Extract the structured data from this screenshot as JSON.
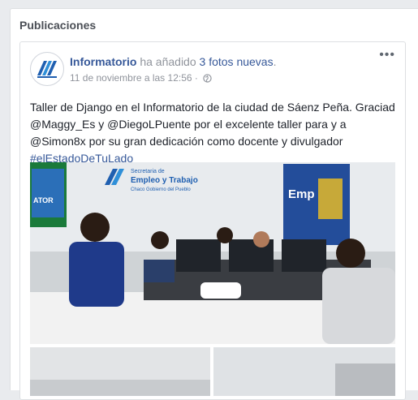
{
  "section": {
    "title": "Publicaciones"
  },
  "post": {
    "author": "Informatorio",
    "action": " ha añadido ",
    "photos_link": "3 fotos nuevas",
    "period": ".",
    "timestamp": "11 de noviembre a las 12:56",
    "separator": " · ",
    "privacy_icon": "globe-icon",
    "more_icon": "more-options-icon",
    "more_label": "•••",
    "text_main": "Taller de Django en el Informatorio de la ciudad de Sáenz Peña. Graciad @Maggy_Es y @DiegoLPuente por el excelente taller para y a @Simon8x por su gran dedicación como docente y divulgador",
    "hashtag": "#elEstadoDeTuLado",
    "photo_signs": {
      "center_line1": "Secretaria de",
      "center_line2": "Empleo y Trabajo",
      "center_line3": "Chaco Gobierno del Pueblo",
      "left_sign": "ATOR",
      "right_sign": "Emp"
    }
  },
  "colors": {
    "link": "#365899",
    "text": "#1d2129",
    "muted": "#90949c",
    "background": "#e9ebee",
    "brand_blue": "#1f5fb0"
  }
}
